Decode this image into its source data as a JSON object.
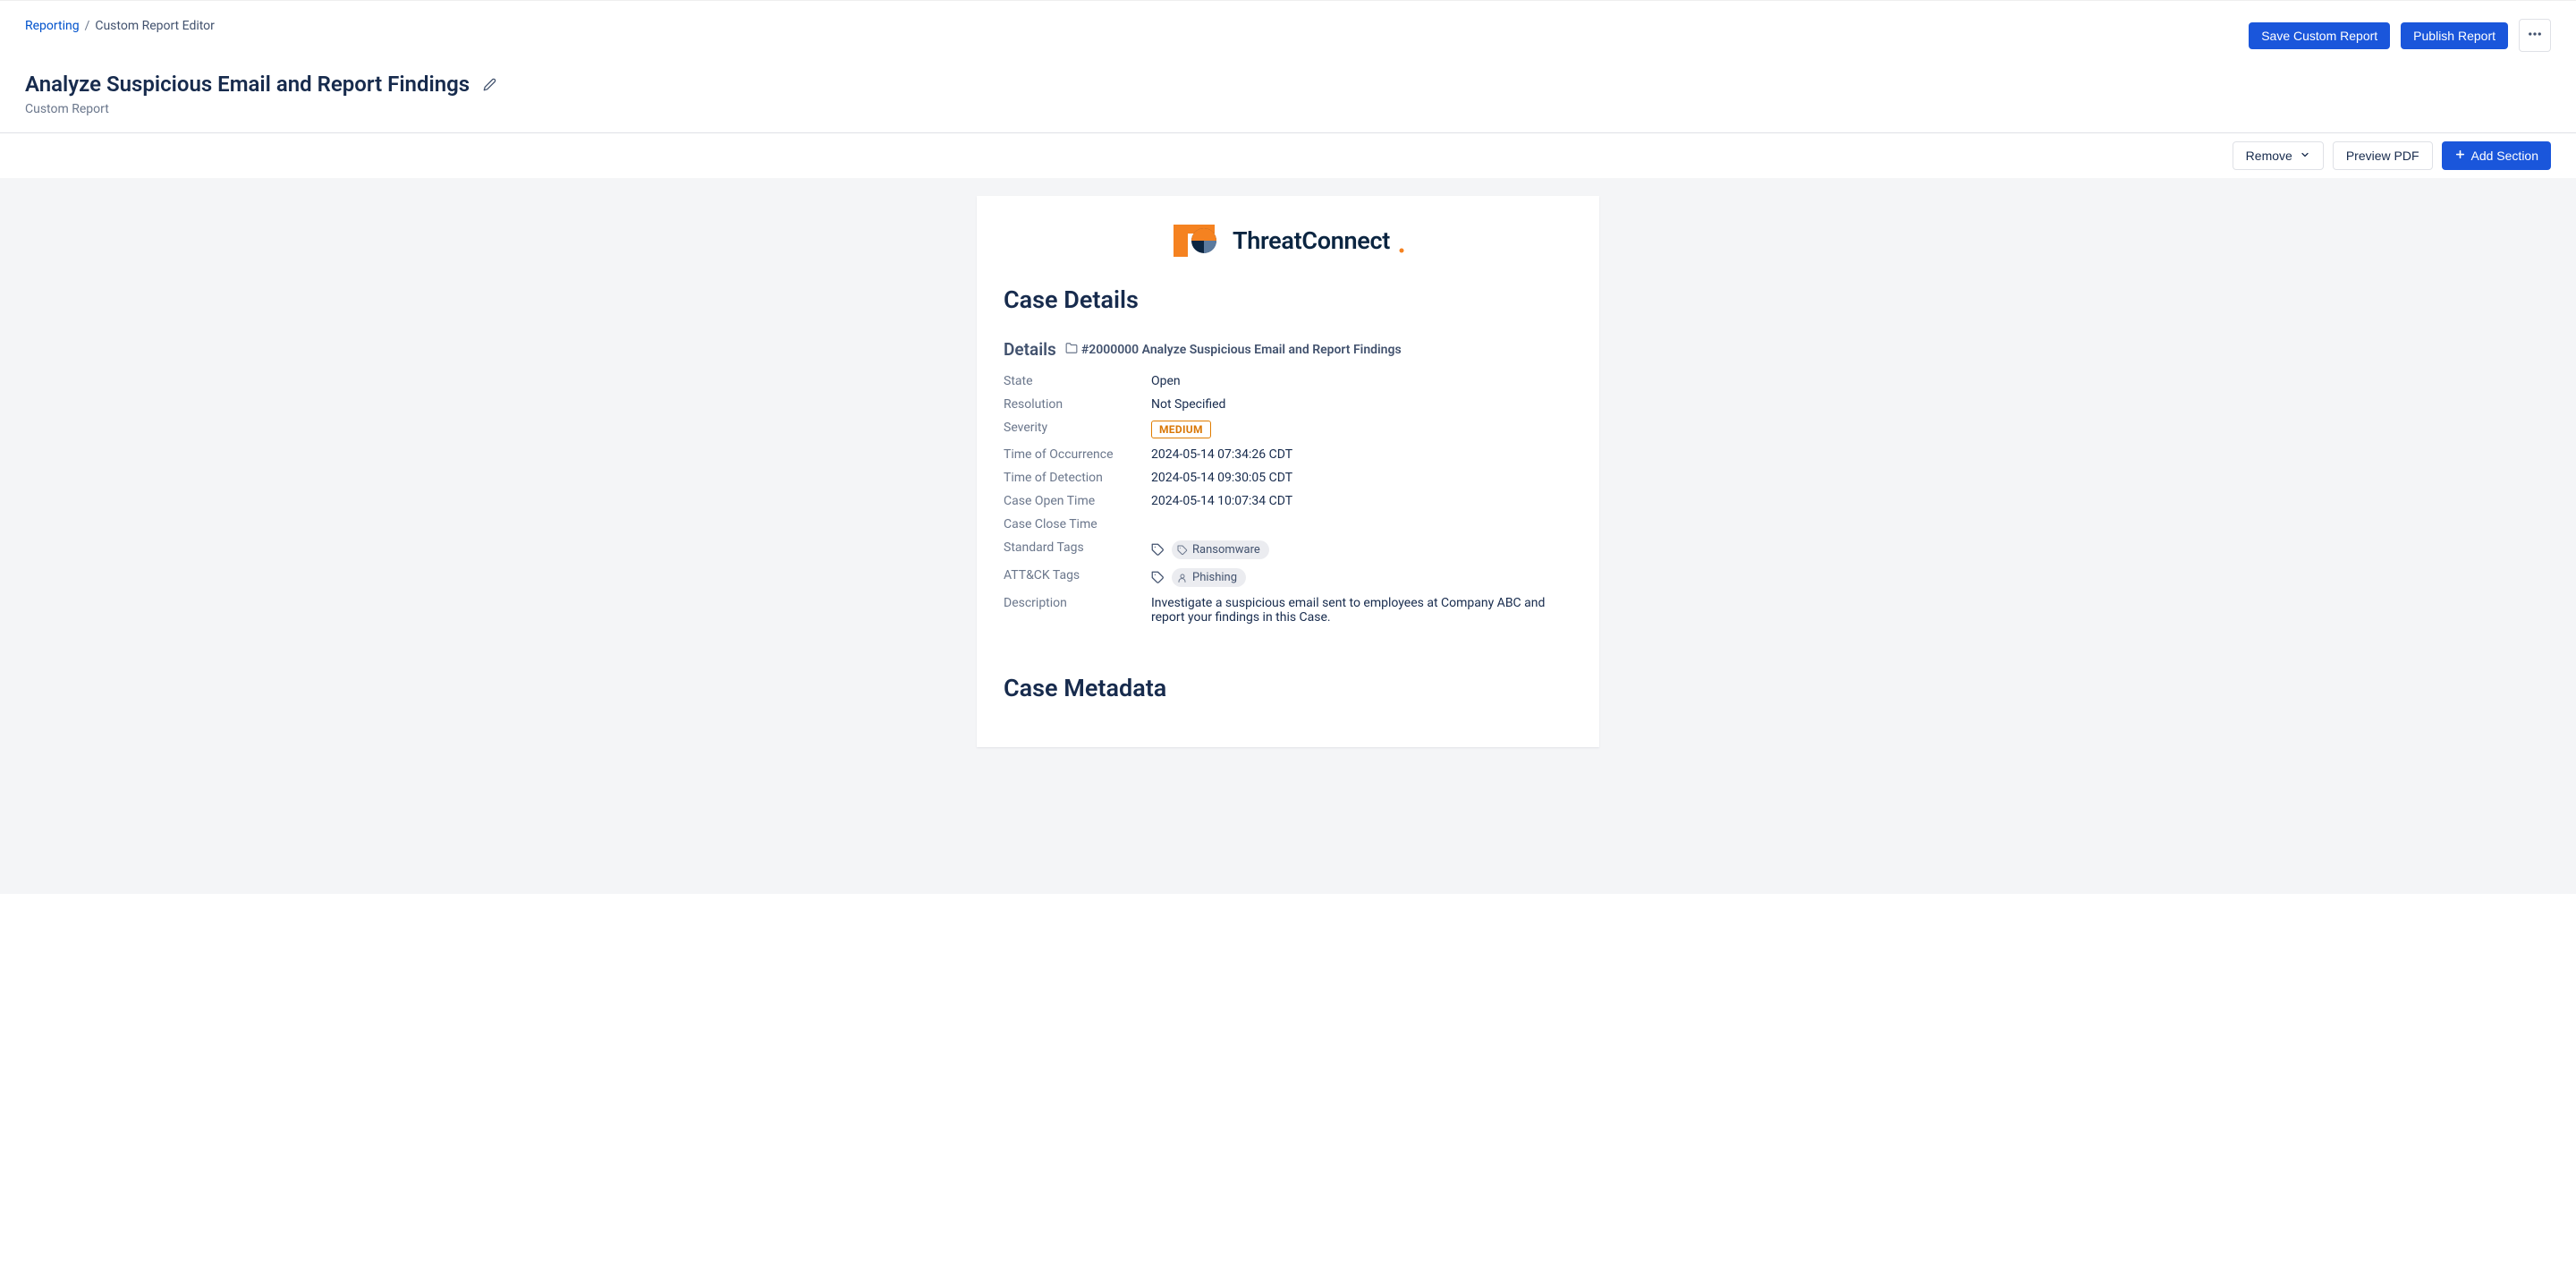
{
  "breadcrumb": {
    "reporting": "Reporting",
    "current": "Custom Report Editor"
  },
  "header_actions": {
    "save": "Save Custom Report",
    "publish": "Publish Report"
  },
  "page": {
    "title": "Analyze Suspicious Email and Report Findings",
    "subtitle": "Custom Report"
  },
  "toolbar": {
    "remove": "Remove",
    "preview": "Preview PDF",
    "add_section": "Add Section"
  },
  "logo": {
    "text": "ThreatConnect"
  },
  "report": {
    "section_case_details": "Case Details",
    "details_label": "Details",
    "case_id": "#2000000 Analyze Suspicious Email and Report Findings",
    "fields": {
      "state": {
        "label": "State",
        "value": "Open"
      },
      "resolution": {
        "label": "Resolution",
        "value": "Not Specified"
      },
      "severity": {
        "label": "Severity",
        "value": "MEDIUM"
      },
      "time_occurrence": {
        "label": "Time of Occurrence",
        "value": "2024-05-14 07:34:26 CDT"
      },
      "time_detection": {
        "label": "Time of Detection",
        "value": "2024-05-14 09:30:05 CDT"
      },
      "case_open": {
        "label": "Case Open Time",
        "value": "2024-05-14 10:07:34 CDT"
      },
      "case_close": {
        "label": "Case Close Time",
        "value": ""
      },
      "standard_tags": {
        "label": "Standard Tags",
        "value": "Ransomware"
      },
      "attck_tags": {
        "label": "ATT&CK Tags",
        "value": "Phishing"
      },
      "description": {
        "label": "Description",
        "value": "Investigate a suspicious email sent to employees at Company ABC and report your findings in this Case."
      }
    },
    "section_case_metadata": "Case Metadata"
  }
}
